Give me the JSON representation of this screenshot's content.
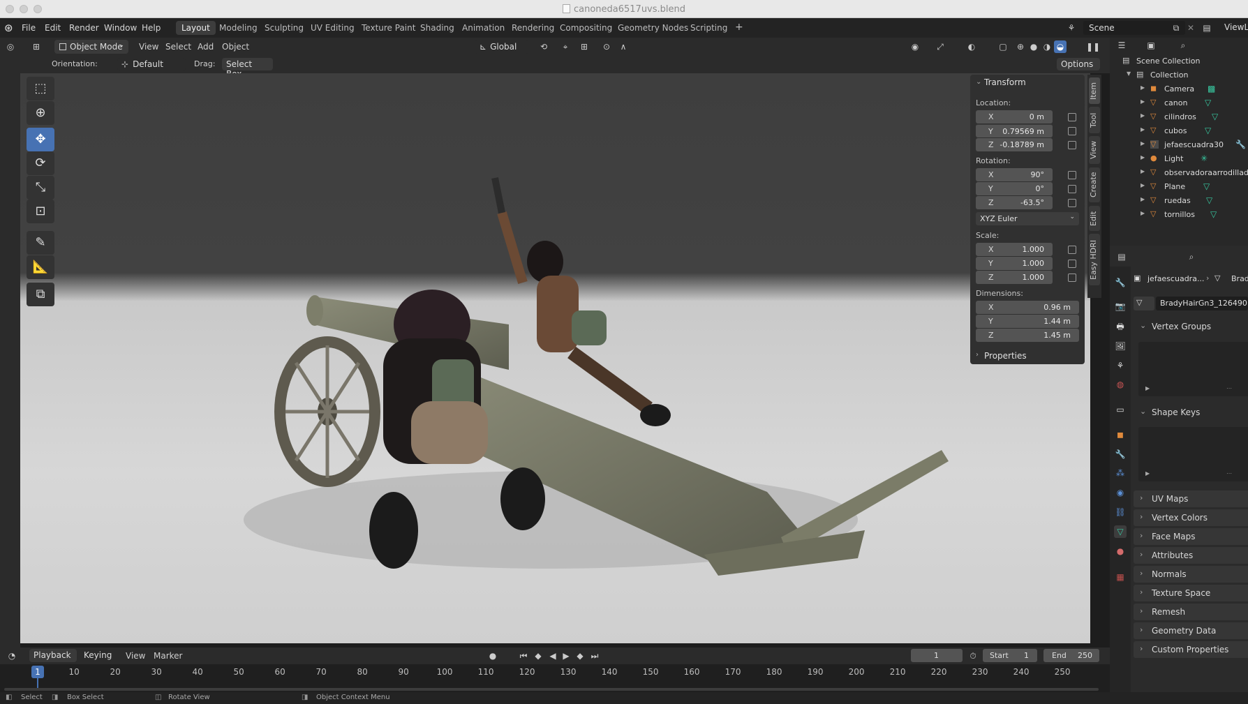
{
  "window": {
    "title": "canoneda6517uvs.blend"
  },
  "menu": {
    "items": [
      "File",
      "Edit",
      "Render",
      "Window",
      "Help"
    ]
  },
  "workspaces": {
    "tabs": [
      "Layout",
      "Modeling",
      "Sculpting",
      "UV Editing",
      "Texture Paint",
      "Shading",
      "Animation",
      "Rendering",
      "Compositing",
      "Geometry Nodes",
      "Scripting"
    ],
    "active": "Layout",
    "add": "+"
  },
  "scene": {
    "label": "Scene",
    "viewlayer": "ViewL"
  },
  "viewport_header": {
    "mode": "Object Mode",
    "view": "View",
    "select": "Select",
    "add": "Add",
    "object": "Object",
    "transform_space": "Global"
  },
  "tool_settings": {
    "orientation_label": "Orientation:",
    "orientation_value": "Default",
    "drag_label": "Drag:",
    "drag_value": "Select Box",
    "options": "Options"
  },
  "npanel": {
    "transform": "Transform",
    "location_label": "Location:",
    "location": [
      {
        "axis": "X",
        "value": "0 m"
      },
      {
        "axis": "Y",
        "value": "0.79569 m"
      },
      {
        "axis": "Z",
        "value": "-0.18789 m"
      }
    ],
    "rotation_label": "Rotation:",
    "rotation": [
      {
        "axis": "X",
        "value": "90°"
      },
      {
        "axis": "Y",
        "value": "0°"
      },
      {
        "axis": "Z",
        "value": "-63.5°"
      }
    ],
    "rotation_mode": "XYZ Euler",
    "scale_label": "Scale:",
    "scale": [
      {
        "axis": "X",
        "value": "1.000"
      },
      {
        "axis": "Y",
        "value": "1.000"
      },
      {
        "axis": "Z",
        "value": "1.000"
      }
    ],
    "dimensions_label": "Dimensions:",
    "dimensions": [
      {
        "axis": "X",
        "value": "0.96 m"
      },
      {
        "axis": "Y",
        "value": "1.44 m"
      },
      {
        "axis": "Z",
        "value": "1.45 m"
      }
    ],
    "properties": "Properties",
    "tabs": [
      "Item",
      "Tool",
      "View",
      "Create",
      "Edit",
      "Easy HDRI"
    ]
  },
  "outliner": {
    "root": "Scene Collection",
    "collection": "Collection",
    "items": [
      "Camera",
      "canon",
      "cilindros",
      "cubos",
      "jefaescuadra30",
      "Light",
      "observadoraarrodillada",
      "Plane",
      "ruedas",
      "tornillos"
    ]
  },
  "properties_editor": {
    "breadcrumb_object": "jefaescuadra...",
    "breadcrumb_data": "Brad",
    "mesh_name": "BradyHairGn3_126490",
    "sections": [
      "Vertex Groups",
      "Shape Keys",
      "UV Maps",
      "Vertex Colors",
      "Face Maps",
      "Attributes",
      "Normals",
      "Texture Space",
      "Remesh",
      "Geometry Data",
      "Custom Properties"
    ]
  },
  "timeline": {
    "playback": "Playback",
    "keying": "Keying",
    "view": "View",
    "marker": "Marker",
    "current_frame": "1",
    "start_label": "Start",
    "start": "1",
    "end_label": "End",
    "end": "250",
    "ticks": [
      "10",
      "20",
      "30",
      "40",
      "50",
      "60",
      "70",
      "80",
      "90",
      "100",
      "110",
      "120",
      "130",
      "140",
      "150",
      "160",
      "170",
      "180",
      "190",
      "200",
      "210",
      "220",
      "230",
      "240",
      "250"
    ],
    "indicator": "1"
  },
  "statusbar": {
    "select": "Select",
    "box_select": "Box Select",
    "rotate_view": "Rotate View",
    "context_menu": "Object Context Menu"
  }
}
